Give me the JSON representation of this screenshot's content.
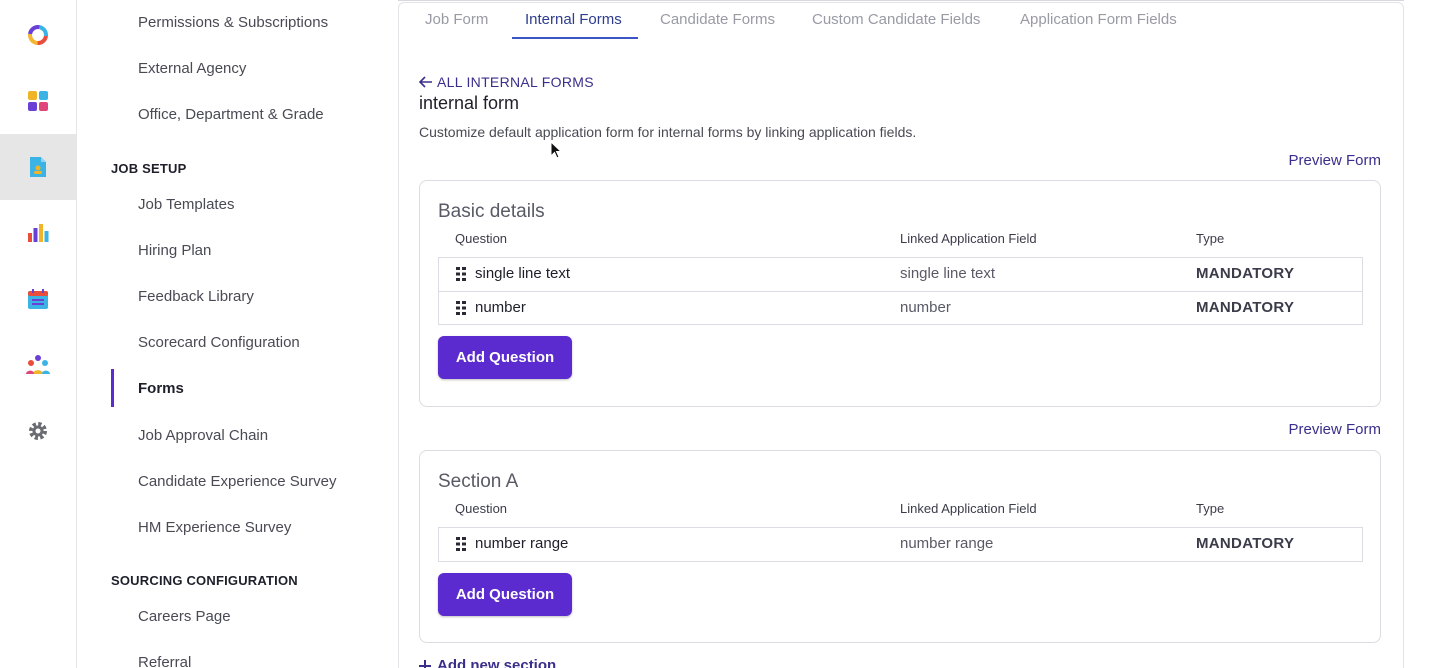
{
  "rail": {
    "icons": [
      "app-logo-icon",
      "dashboard-icon",
      "jobs-icon",
      "reports-icon",
      "calendar-icon",
      "team-icon",
      "settings-icon"
    ],
    "active": "jobs-icon"
  },
  "sidebar": {
    "items_top": [
      "Permissions & Subscriptions",
      "External Agency",
      "Office, Department & Grade"
    ],
    "section_job_setup": "JOB SETUP",
    "job_setup_items": [
      "Job Templates",
      "Hiring Plan",
      "Feedback Library",
      "Scorecard Configuration",
      "Forms",
      "Job Approval Chain",
      "Candidate Experience Survey",
      "HM Experience Survey"
    ],
    "section_sourcing": "SOURCING CONFIGURATION",
    "sourcing_items": [
      "Careers Page",
      "Referral"
    ],
    "active_item": "Forms"
  },
  "tabs": [
    "Job Form",
    "Internal Forms",
    "Candidate Forms",
    "Custom Candidate Fields",
    "Application Form Fields"
  ],
  "active_tab": "Internal Forms",
  "main": {
    "back_label": "ALL INTERNAL FORMS",
    "form_title": "internal form",
    "description": "Customize default application form for internal forms by linking application fields.",
    "preview_label": "Preview Form",
    "add_question_label": "Add Question",
    "add_section_label": "Add new section",
    "columns": [
      "Question",
      "Linked Application Field",
      "Type"
    ],
    "sections": [
      {
        "title": "Basic details",
        "rows": [
          {
            "question": "single line text",
            "field": "single line text",
            "type": "MANDATORY"
          },
          {
            "question": "number",
            "field": "number",
            "type": "MANDATORY"
          }
        ]
      },
      {
        "title": "Section A",
        "rows": [
          {
            "question": "number range",
            "field": "number range",
            "type": "MANDATORY"
          }
        ]
      }
    ]
  },
  "colors": {
    "accent": "#5b2bcf",
    "link": "#3a2e8c",
    "tab_active": "#2f3d8f"
  }
}
